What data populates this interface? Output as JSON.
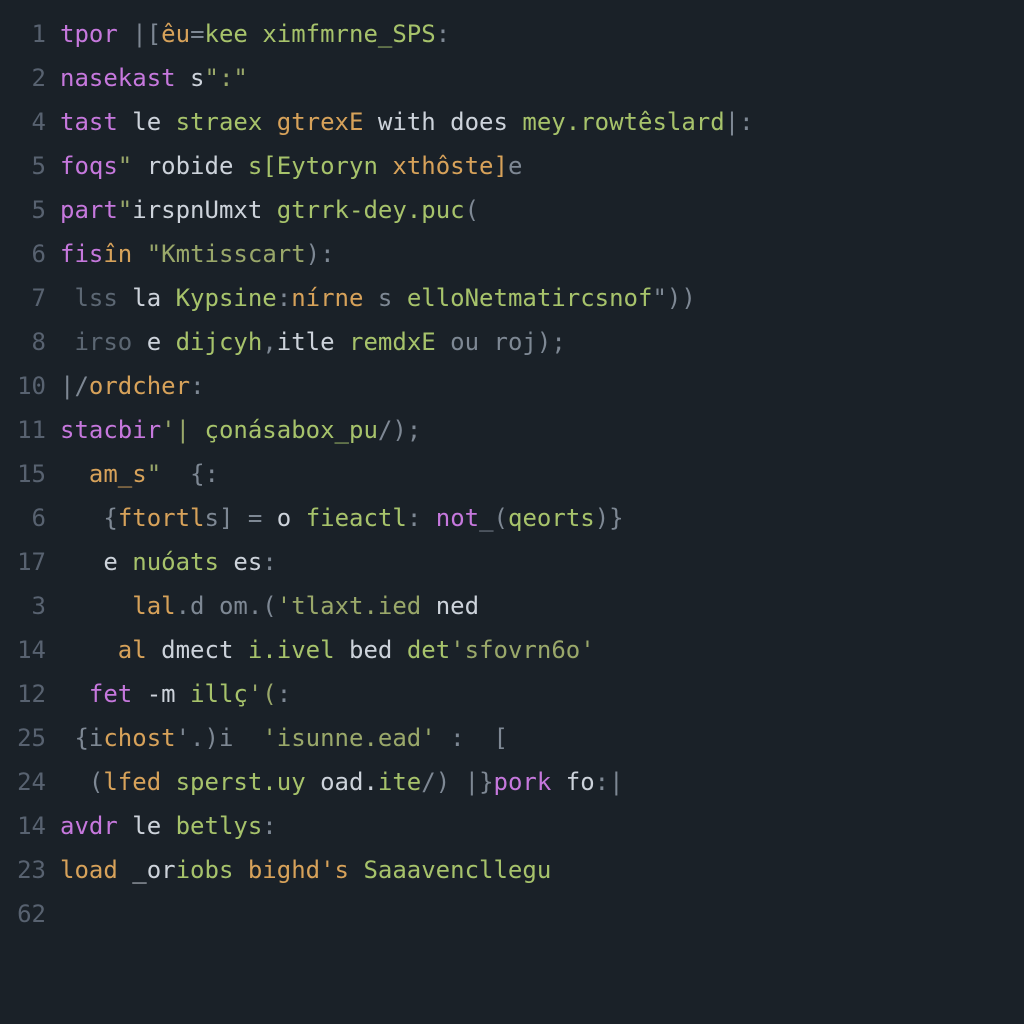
{
  "editor": {
    "background": "#1a2128",
    "gutter_color": "#586270",
    "font": "monospace",
    "lines": [
      {
        "num": "1",
        "tokens": [
          {
            "cls": "kw",
            "t": "tpor"
          },
          {
            "cls": "op",
            "t": " |["
          },
          {
            "cls": "id",
            "t": "êu"
          },
          {
            "cls": "op",
            "t": "="
          },
          {
            "cls": "fn",
            "t": "kee "
          },
          {
            "cls": "fn",
            "t": "ximfmrne_SPS"
          },
          {
            "cls": "op",
            "t": ":"
          }
        ]
      },
      {
        "num": "2",
        "tokens": [
          {
            "cls": "kw",
            "t": "nasekast"
          },
          {
            "cls": "pl",
            "t": " s"
          },
          {
            "cls": "str",
            "t": "\":\""
          }
        ]
      },
      {
        "num": "4",
        "tokens": [
          {
            "cls": "kw",
            "t": "tast"
          },
          {
            "cls": "pl",
            "t": " le "
          },
          {
            "cls": "fn",
            "t": "straex "
          },
          {
            "cls": "id",
            "t": "gtrexE"
          },
          {
            "cls": "pl",
            "t": " with does "
          },
          {
            "cls": "fn",
            "t": "mey.rowtêslard"
          },
          {
            "cls": "op",
            "t": "|:"
          }
        ]
      },
      {
        "num": "5",
        "tokens": [
          {
            "cls": "kw",
            "t": "foqs"
          },
          {
            "cls": "str",
            "t": "\" "
          },
          {
            "cls": "pl",
            "t": "robide "
          },
          {
            "cls": "fn",
            "t": "s[Eytoryn"
          },
          {
            "cls": "id",
            "t": " xthôste]"
          },
          {
            "cls": "op",
            "t": "e"
          }
        ]
      },
      {
        "num": "5",
        "tokens": [
          {
            "cls": "kw",
            "t": "part"
          },
          {
            "cls": "str",
            "t": "\""
          },
          {
            "cls": "pl",
            "t": "irspnUmxt "
          },
          {
            "cls": "fn",
            "t": "gtrrk-dey.puc"
          },
          {
            "cls": "op",
            "t": "("
          }
        ]
      },
      {
        "num": "6",
        "tokens": [
          {
            "cls": "kw",
            "t": "fis"
          },
          {
            "cls": "id",
            "t": "în "
          },
          {
            "cls": "str",
            "t": "\"Kmtisscart"
          },
          {
            "cls": "op",
            "t": "):"
          }
        ]
      },
      {
        "num": "7",
        "tokens": [
          {
            "cls": "cm",
            "t": " lss"
          },
          {
            "cls": "pl",
            "t": " la "
          },
          {
            "cls": "fn",
            "t": "Kypsine"
          },
          {
            "cls": "op",
            "t": ":"
          },
          {
            "cls": "id",
            "t": "nírne "
          },
          {
            "cls": "op",
            "t": "s "
          },
          {
            "cls": "fn",
            "t": "elloNetmatircsnof"
          },
          {
            "cls": "op",
            "t": "\"))"
          }
        ]
      },
      {
        "num": "8",
        "tokens": [
          {
            "cls": "cm",
            "t": " irso"
          },
          {
            "cls": "pl",
            "t": " e "
          },
          {
            "cls": "fn",
            "t": "dijcyh"
          },
          {
            "cls": "op",
            "t": ","
          },
          {
            "cls": "pl",
            "t": "itle "
          },
          {
            "cls": "fn",
            "t": "remdxE"
          },
          {
            "cls": "op",
            "t": " ou ro"
          },
          {
            "cls": "op",
            "t": "j);"
          }
        ]
      },
      {
        "num": "10",
        "tokens": [
          {
            "cls": "op",
            "t": "|/"
          },
          {
            "cls": "id",
            "t": "ordcher"
          },
          {
            "cls": "op",
            "t": ":"
          }
        ]
      },
      {
        "num": "11",
        "tokens": [
          {
            "cls": "kw",
            "t": "stacbir"
          },
          {
            "cls": "str",
            "t": "'|"
          },
          {
            "cls": "fn",
            "t": " çonásabox_pu"
          },
          {
            "cls": "op",
            "t": "/);"
          }
        ]
      },
      {
        "num": "15",
        "tokens": [
          {
            "cls": "pl",
            "t": "  "
          },
          {
            "cls": "id",
            "t": "am_s"
          },
          {
            "cls": "str",
            "t": "\"  "
          },
          {
            "cls": "op",
            "t": "{:"
          }
        ]
      },
      {
        "num": "6",
        "tokens": [
          {
            "cls": "pl",
            "t": "   "
          },
          {
            "cls": "op",
            "t": "{"
          },
          {
            "cls": "id",
            "t": "ftortl"
          },
          {
            "cls": "op",
            "t": "s] "
          },
          {
            "cls": "op",
            "t": "= "
          },
          {
            "cls": "pl",
            "t": "o "
          },
          {
            "cls": "fn",
            "t": "fieactl"
          },
          {
            "cls": "op",
            "t": ": "
          },
          {
            "cls": "kw",
            "t": "not"
          },
          {
            "cls": "op",
            "t": "_("
          },
          {
            "cls": "fn",
            "t": "qeorts"
          },
          {
            "cls": "op",
            "t": ")}"
          }
        ]
      },
      {
        "num": "17",
        "tokens": [
          {
            "cls": "pl",
            "t": "   e "
          },
          {
            "cls": "fn",
            "t": "nuóats"
          },
          {
            "cls": "pl",
            "t": " es"
          },
          {
            "cls": "op",
            "t": ":"
          }
        ]
      },
      {
        "num": "3",
        "tokens": [
          {
            "cls": "pl",
            "t": "     "
          },
          {
            "cls": "id",
            "t": "lal"
          },
          {
            "cls": "op",
            "t": ".d om.("
          },
          {
            "cls": "str",
            "t": "'tlaxt.ied"
          },
          {
            "cls": "pl",
            "t": " ned"
          }
        ]
      },
      {
        "num": "14",
        "tokens": [
          {
            "cls": "pl",
            "t": "    "
          },
          {
            "cls": "id",
            "t": "al"
          },
          {
            "cls": "pl",
            "t": " dmect "
          },
          {
            "cls": "fn",
            "t": "i.ivel"
          },
          {
            "cls": "pl",
            "t": " bed "
          },
          {
            "cls": "fn",
            "t": "det"
          },
          {
            "cls": "str",
            "t": "'sfovrn6o'"
          }
        ]
      },
      {
        "num": "12",
        "tokens": [
          {
            "cls": "pl",
            "t": "  "
          },
          {
            "cls": "kw",
            "t": "fet"
          },
          {
            "cls": "pl",
            "t": " -m "
          },
          {
            "cls": "fn",
            "t": "illç"
          },
          {
            "cls": "str",
            "t": "'("
          },
          {
            "cls": "op",
            "t": ":"
          }
        ]
      },
      {
        "num": "25",
        "tokens": [
          {
            "cls": "op",
            "t": " {i"
          },
          {
            "cls": "id",
            "t": "chost"
          },
          {
            "cls": "op",
            "t": "'.)i  "
          },
          {
            "cls": "str",
            "t": "'isunne.ead'"
          },
          {
            "cls": "op",
            "t": " :  ["
          }
        ]
      },
      {
        "num": "24",
        "tokens": [
          {
            "cls": "pl",
            "t": "  "
          },
          {
            "cls": "op",
            "t": "("
          },
          {
            "cls": "id",
            "t": "lfed"
          },
          {
            "cls": "pl",
            "t": " "
          },
          {
            "cls": "fn",
            "t": "sperst.uy"
          },
          {
            "cls": "pl",
            "t": " oad."
          },
          {
            "cls": "fn",
            "t": "ite"
          },
          {
            "cls": "op",
            "t": "/) |}"
          },
          {
            "cls": "kw",
            "t": "pork"
          },
          {
            "cls": "pl",
            "t": " fo"
          },
          {
            "cls": "op",
            "t": ":|"
          }
        ]
      },
      {
        "num": "14",
        "tokens": [
          {
            "cls": "kw",
            "t": "avdr"
          },
          {
            "cls": "pl",
            "t": " le "
          },
          {
            "cls": "fn",
            "t": "betlys"
          },
          {
            "cls": "op",
            "t": ":"
          }
        ]
      },
      {
        "num": "23",
        "tokens": [
          {
            "cls": "id",
            "t": "load"
          },
          {
            "cls": "pl",
            "t": " _or"
          },
          {
            "cls": "fn",
            "t": "iobs "
          },
          {
            "cls": "id",
            "t": "bighd's "
          },
          {
            "cls": "fn",
            "t": "Saaavencllegu"
          }
        ]
      },
      {
        "num": "62",
        "tokens": []
      }
    ]
  }
}
